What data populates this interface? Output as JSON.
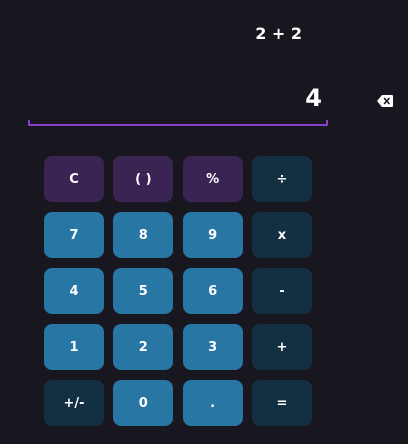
{
  "display": {
    "expression": "2 + 2",
    "result": "4"
  },
  "icons": {
    "backspace": "backspace-icon"
  },
  "colors": {
    "background": "#18171f",
    "accent_line": "#8a3fd0",
    "function_key": "#3a2454",
    "number_key": "#2876a3",
    "operator_key": "#133043",
    "text": "#ffffff"
  },
  "keys": [
    {
      "label": "C",
      "kind": "fn",
      "name": "clear"
    },
    {
      "label": "( )",
      "kind": "fn",
      "name": "parentheses"
    },
    {
      "label": "%",
      "kind": "fn",
      "name": "percent"
    },
    {
      "label": "÷",
      "kind": "op",
      "name": "divide"
    },
    {
      "label": "7",
      "kind": "num",
      "name": "digit-7"
    },
    {
      "label": "8",
      "kind": "num",
      "name": "digit-8"
    },
    {
      "label": "9",
      "kind": "num",
      "name": "digit-9"
    },
    {
      "label": "x",
      "kind": "op",
      "name": "multiply"
    },
    {
      "label": "4",
      "kind": "num",
      "name": "digit-4"
    },
    {
      "label": "5",
      "kind": "num",
      "name": "digit-5"
    },
    {
      "label": "6",
      "kind": "num",
      "name": "digit-6"
    },
    {
      "label": "-",
      "kind": "op",
      "name": "subtract"
    },
    {
      "label": "1",
      "kind": "num",
      "name": "digit-1"
    },
    {
      "label": "2",
      "kind": "num",
      "name": "digit-2"
    },
    {
      "label": "3",
      "kind": "num",
      "name": "digit-3"
    },
    {
      "label": "+",
      "kind": "op",
      "name": "add"
    },
    {
      "label": "+/-",
      "kind": "op",
      "name": "toggle-sign"
    },
    {
      "label": "0",
      "kind": "num",
      "name": "digit-0"
    },
    {
      "label": ".",
      "kind": "num",
      "name": "decimal"
    },
    {
      "label": "=",
      "kind": "op",
      "name": "equals"
    }
  ]
}
